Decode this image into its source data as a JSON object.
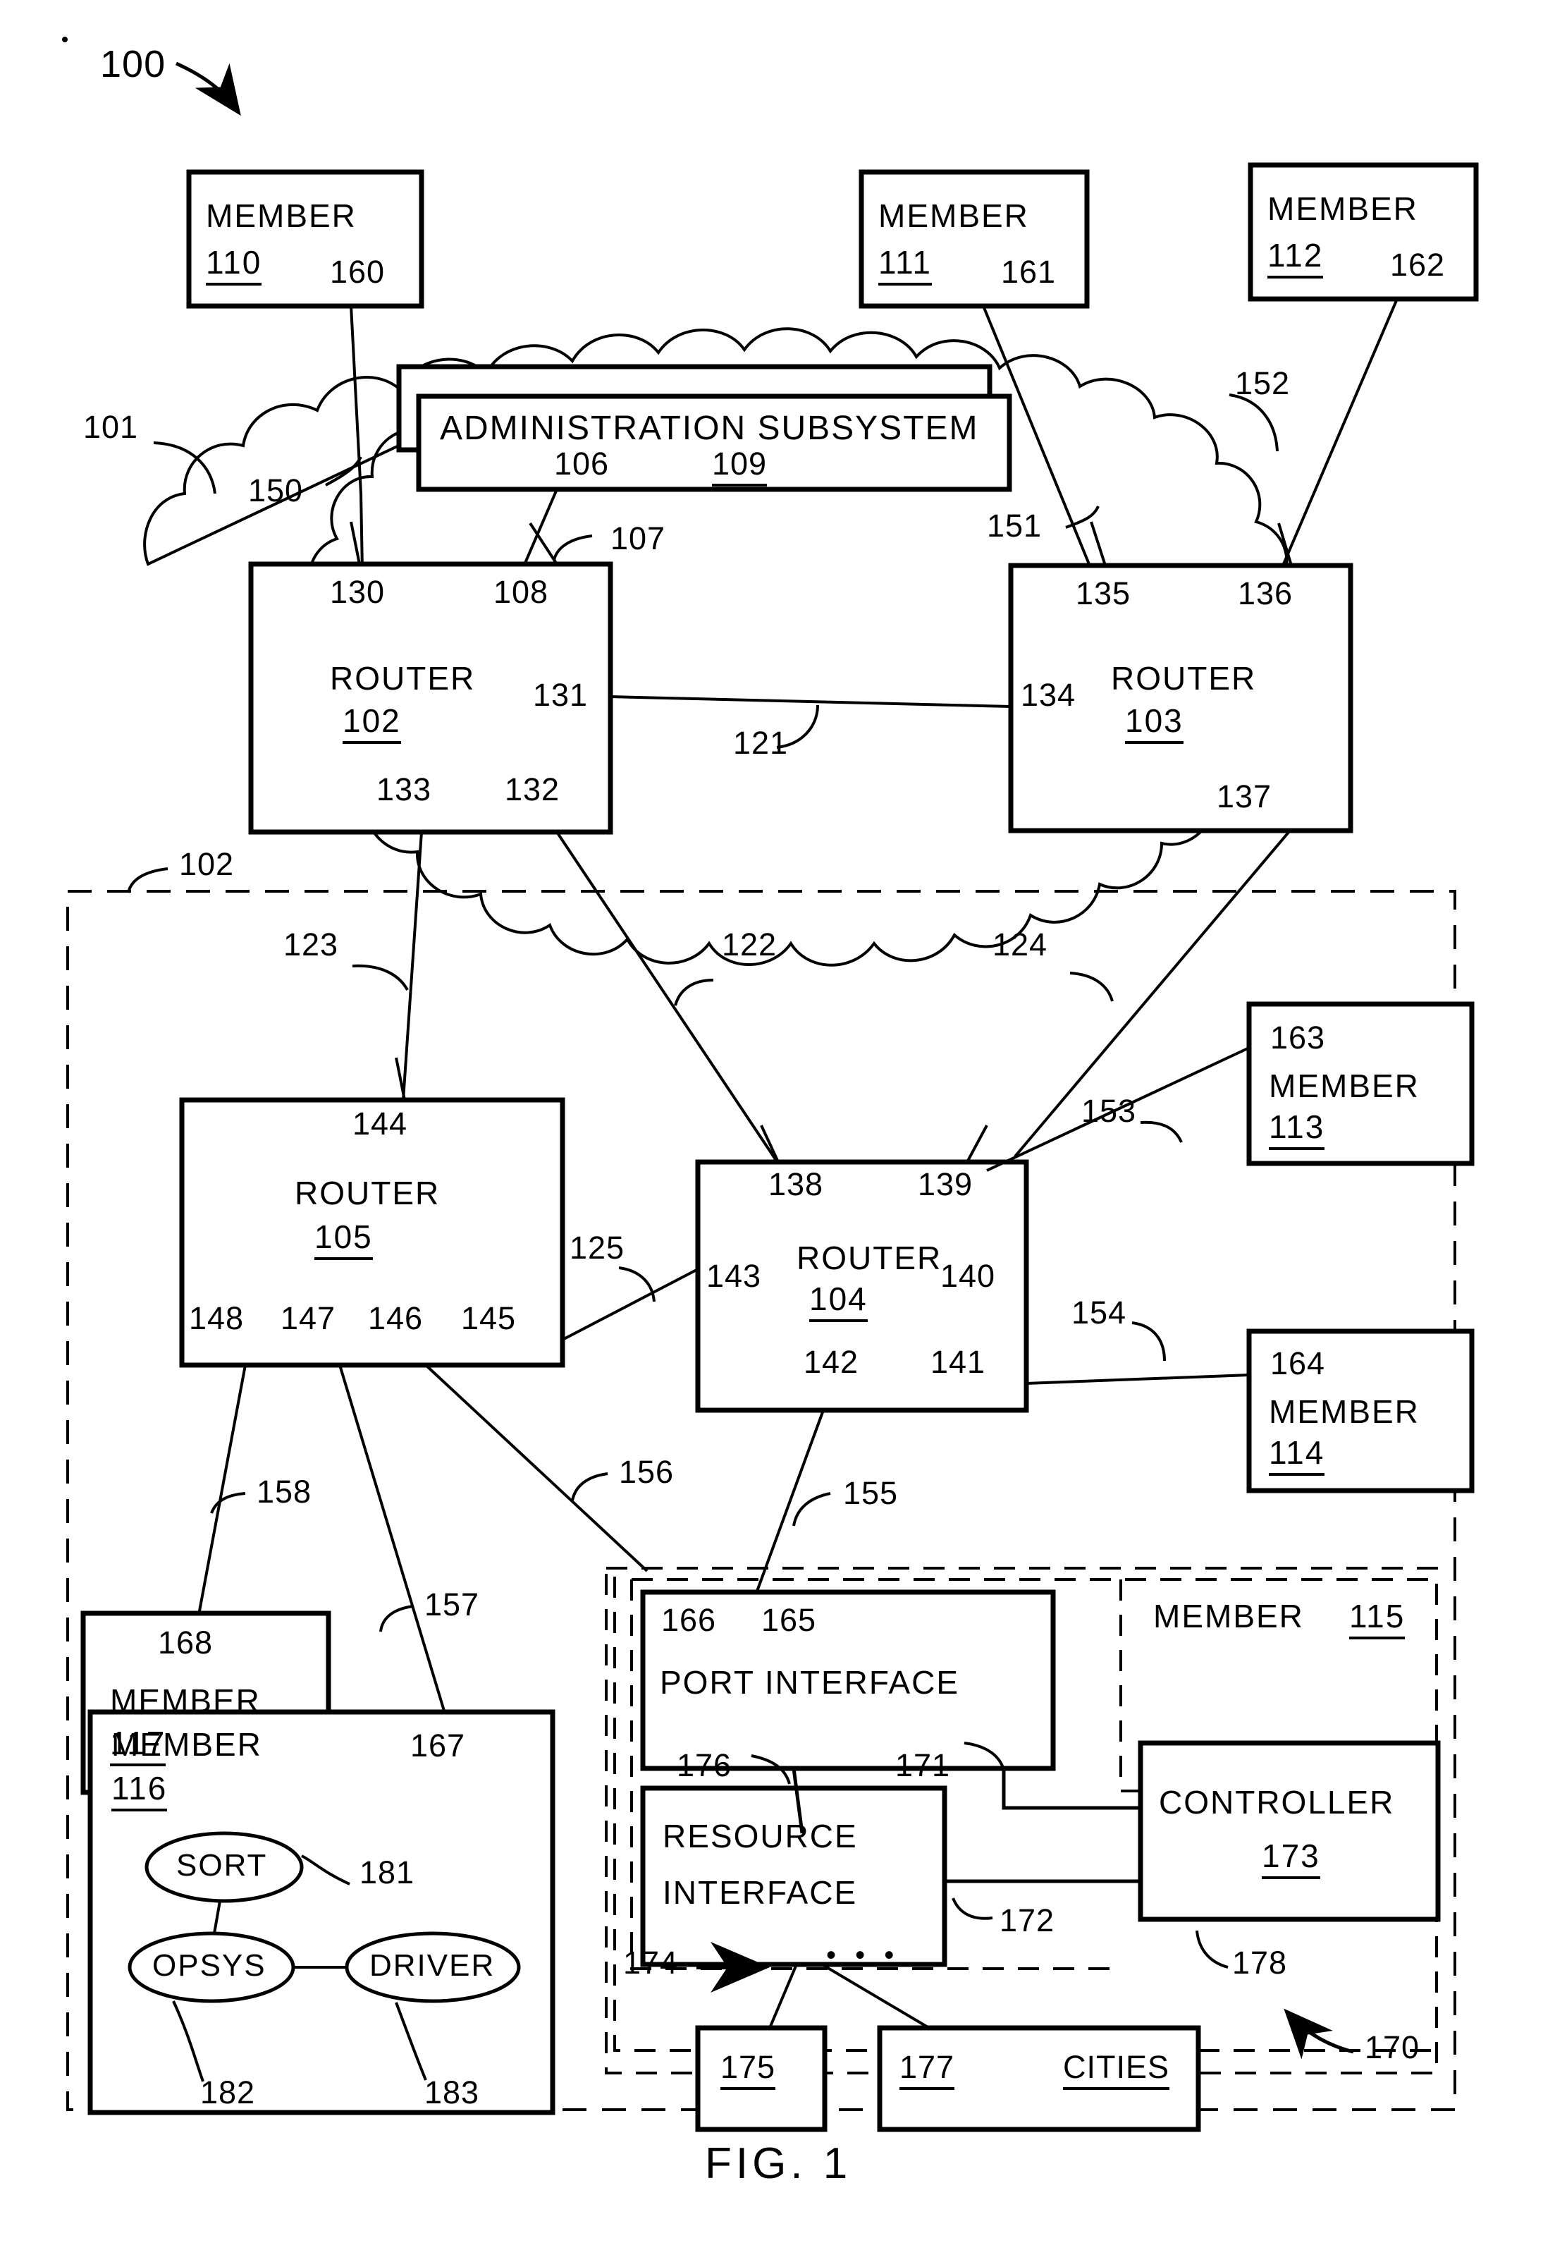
{
  "figure": {
    "caption": "FIG.  1",
    "system_ref": "100"
  },
  "cloud_network": {
    "ref_outer": "101",
    "ref_inner": "102"
  },
  "admin_subsystem": {
    "title": "ADMINISTRATION  SUBSYSTEM",
    "ref_left": "106",
    "ref_right": "109",
    "link_ref": "107"
  },
  "members": [
    {
      "name": "MEMBER",
      "ref": "110",
      "port": "160"
    },
    {
      "name": "MEMBER",
      "ref": "111",
      "port": "161"
    },
    {
      "name": "MEMBER",
      "ref": "112",
      "port": "162"
    },
    {
      "name": "MEMBER",
      "ref": "113",
      "port": "163"
    },
    {
      "name": "MEMBER",
      "ref": "114",
      "port": "164"
    },
    {
      "name": "MEMBER",
      "ref": "117",
      "port": "168"
    },
    {
      "name": "MEMBER",
      "ref": "116",
      "port": "167"
    }
  ],
  "member115": {
    "name": "MEMBER",
    "ref": "115"
  },
  "routers": [
    {
      "name": "ROUTER",
      "ref": "102",
      "ports": {
        "top_left": "130",
        "top_right": "108",
        "right": "131",
        "bottom_left": "133",
        "bottom_right": "132"
      }
    },
    {
      "name": "ROUTER",
      "ref": "103",
      "ports": {
        "top_left": "135",
        "top_right": "136",
        "left": "134",
        "bottom_right": "137"
      }
    },
    {
      "name": "ROUTER",
      "ref": "104",
      "ports": {
        "top_left": "138",
        "top_right": "139",
        "left": "143",
        "right": "140",
        "bottom_left": "142",
        "bottom_right": "141"
      }
    },
    {
      "name": "ROUTER",
      "ref": "105",
      "ports": {
        "top": "144",
        "bottom1": "148",
        "bottom2": "147",
        "bottom3": "146",
        "bottom4": "145"
      }
    }
  ],
  "links": {
    "router102_to_router103": "121",
    "router102_to_router104": "122",
    "router102_to_router105": "123",
    "router103_to_router104": "124",
    "router105_to_router104": "125",
    "member110_link": "150",
    "member111_link": "151",
    "member112_link": "152",
    "member113_link": "153",
    "member114_link": "154",
    "member115_link": "155",
    "member115_alt_link": "156",
    "member116_link": "157",
    "member117_link": "158"
  },
  "member115_detail": {
    "port_interface": {
      "label": "PORT  INTERFACE",
      "ref_left": "166",
      "ref_right": "165"
    },
    "resource_interface": {
      "line1": "RESOURCE",
      "line2": "INTERFACE",
      "link_to_port": "176",
      "link_to_controller": "172"
    },
    "controller": {
      "label": "CONTROLLER",
      "ref": "173",
      "link_to_port": "171"
    },
    "resources_group_ref": "170",
    "resources_boundary_ref": "178",
    "resources_arrow_ref": "174",
    "ellipsis": "•  •  •",
    "resource_items": [
      {
        "ref": "175",
        "label": ""
      },
      {
        "ref": "177",
        "label": "CITIES"
      }
    ]
  },
  "member116_detail": {
    "nodes": [
      {
        "label": "SORT",
        "ref": "181"
      },
      {
        "label": "OPSYS",
        "ref": "182"
      },
      {
        "label": "DRIVER",
        "ref": "183"
      }
    ]
  }
}
